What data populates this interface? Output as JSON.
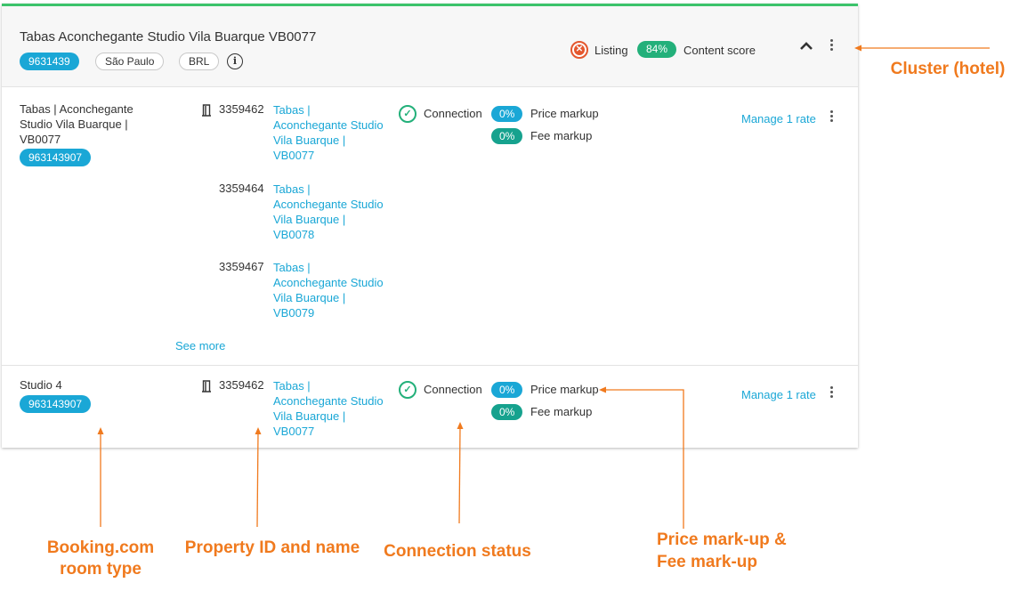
{
  "cluster": {
    "title": "Tabas Aconchegante Studio Vila Buarque VB0077",
    "id_badge": "9631439",
    "city": "São Paulo",
    "currency": "BRL",
    "info_icon": "info-icon",
    "listing_label": "Listing",
    "content_score_value": "84%",
    "content_score_label": "Content score",
    "accent_color": "#3cc36b"
  },
  "rooms": [
    {
      "name_lines": [
        "Tabas | Aconchegante",
        "Studio Vila Buarque |",
        "VB0077"
      ],
      "room_id": "963143907",
      "properties": [
        {
          "id": "3359462",
          "name_lines": [
            "Tabas |",
            "Aconchegante Studio",
            "Vila Buarque |",
            "VB0077"
          ]
        },
        {
          "id": "3359464",
          "name_lines": [
            "Tabas |",
            "Aconchegante Studio",
            "Vila Buarque |",
            "VB0078"
          ]
        },
        {
          "id": "3359467",
          "name_lines": [
            "Tabas |",
            "Aconchegante Studio",
            "Vila Buarque |",
            "VB0079"
          ]
        }
      ],
      "see_more": "See more",
      "connection": "Connection",
      "price_markup_value": "0%",
      "price_markup_label": "Price markup",
      "fee_markup_value": "0%",
      "fee_markup_label": "Fee markup",
      "manage": "Manage 1 rate"
    },
    {
      "name_lines": [
        "Studio 4"
      ],
      "room_id": "963143907",
      "properties": [
        {
          "id": "3359462",
          "name_lines": [
            "Tabas |",
            "Aconchegante Studio",
            "Vila Buarque |",
            "VB0077"
          ]
        }
      ],
      "connection": "Connection",
      "price_markup_value": "0%",
      "price_markup_label": "Price markup",
      "fee_markup_value": "0%",
      "fee_markup_label": "Fee markup",
      "manage": "Manage 1 rate"
    }
  ],
  "annotations": {
    "cluster": "Cluster (hotel)",
    "room_type": [
      "Booking.com",
      "room type"
    ],
    "property": "Property ID and name",
    "connection": "Connection status",
    "markup": [
      "Price mark-up &",
      "Fee mark-up"
    ],
    "color": "#f07a1e"
  }
}
